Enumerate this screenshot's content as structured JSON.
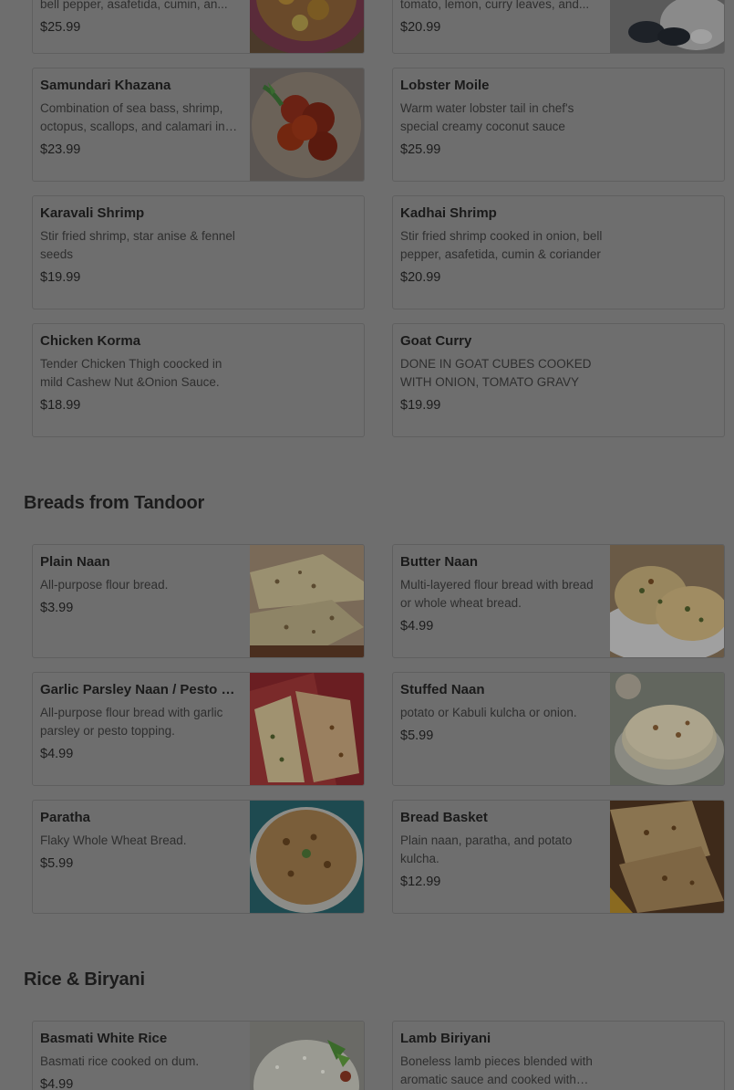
{
  "sections": [
    {
      "title": "Breads from Tandoor"
    },
    {
      "title": "Rice & Biryani"
    }
  ],
  "items": {
    "top_left_partial": {
      "desc": "bell pepper, asafetida, cumin, an...",
      "price": "$25.99"
    },
    "top_right_partial": {
      "desc": "tomato, lemon, curry leaves, and...",
      "price": "$20.99"
    },
    "samundari": {
      "name": "Samundari Khazana",
      "desc": "Combination of sea bass, shrimp, octopus, scallops, and calamari in a...",
      "price": "$23.99"
    },
    "lobster": {
      "name": "Lobster Moile",
      "desc": "Warm water lobster tail in chef's special creamy coconut sauce",
      "price": "$25.99"
    },
    "karavali": {
      "name": "Karavali Shrimp",
      "desc": "Stir fried shrimp, star anise & fennel seeds",
      "price": "$19.99"
    },
    "kadhai": {
      "name": "Kadhai Shrimp",
      "desc": "Stir fried shrimp cooked in onion, bell pepper, asafetida, cumin & coriander",
      "price": "$20.99"
    },
    "korma": {
      "name": "Chicken Korma",
      "desc": "Tender Chicken Thigh coocked in mild Cashew Nut &Onion Sauce.",
      "price": "$18.99"
    },
    "goat": {
      "name": "Goat Curry",
      "desc": "DONE IN GOAT CUBES COOKED WITH ONION, TOMATO GRAVY",
      "price": "$19.99"
    },
    "plain_naan": {
      "name": "Plain Naan",
      "desc": "All-purpose flour bread.",
      "price": "$3.99"
    },
    "butter_naan": {
      "name": "Butter Naan",
      "desc": "Multi-layered flour bread with bread or whole wheat bread.",
      "price": "$4.99"
    },
    "garlic_naan": {
      "name": "Garlic Parsley Naan / Pesto Naan",
      "desc": "All-purpose flour bread with garlic parsley or pesto topping.",
      "price": "$4.99"
    },
    "stuffed_naan": {
      "name": "Stuffed Naan",
      "desc": "potato or Kabuli kulcha or onion.",
      "price": "$5.99"
    },
    "paratha": {
      "name": "Paratha",
      "desc": "Flaky Whole Wheat Bread.",
      "price": "$5.99"
    },
    "bread_basket": {
      "name": "Bread Basket",
      "desc": "Plain naan, paratha, and potato kulcha.",
      "price": "$12.99"
    },
    "basmati": {
      "name": "Basmati White Rice",
      "desc": "Basmati rice cooked on dum.",
      "price": "$4.99"
    },
    "lamb_biriyani": {
      "name": "Lamb Biriyani",
      "desc": "Boneless lamb pieces blended with aromatic sauce and cooked with rice.",
      "price": ""
    }
  },
  "colors": {
    "backdrop": "#6e6e6e",
    "card_border": "#5f5f5f",
    "text": "#1a1a1a"
  }
}
